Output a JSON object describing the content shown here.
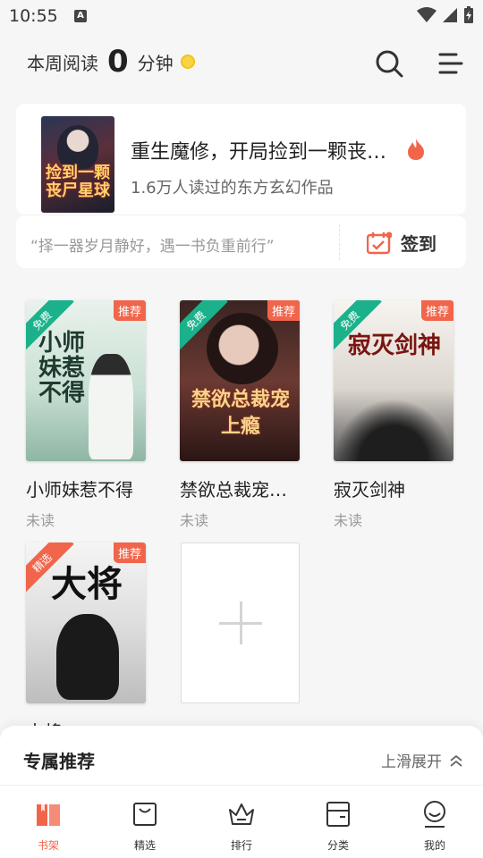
{
  "status_bar": {
    "time": "10:55",
    "notif_icon": "A"
  },
  "header": {
    "reading_prefix": "本周阅读",
    "reading_minutes": "0",
    "reading_suffix": "分钟",
    "coin_color": "#f7d347"
  },
  "featured": {
    "cover_title": "捡到一颗丧尸星球",
    "title": "重生魔修，开局捡到一颗丧尸星球",
    "subtitle": "1.6万人读过的东方玄幻作品"
  },
  "quote_bar": {
    "quote": "“择一器岁月静好，遇一书负重前行”",
    "sign_label": "签到"
  },
  "books": [
    {
      "title": "小师妹惹不得",
      "status": "未读",
      "badge": "推荐",
      "ribbon": "免费",
      "cover_text": "小师妹惹不得"
    },
    {
      "title": "禁欲总裁宠上瘾",
      "status": "未读",
      "badge": "推荐",
      "ribbon": "免费",
      "cover_text": "禁欲总裁宠上瘾"
    },
    {
      "title": "寂灭剑神",
      "status": "未读",
      "badge": "推荐",
      "ribbon": "免费",
      "cover_text": "寂灭剑神"
    },
    {
      "title": "大将",
      "status": "",
      "badge": "推荐",
      "ribbon": "精选",
      "cover_text": "大将"
    }
  ],
  "sheet": {
    "title": "专属推荐",
    "expand_label": "上滑展开"
  },
  "tabs": [
    {
      "label": "书架",
      "icon": "bookshelf-icon"
    },
    {
      "label": "精选",
      "icon": "bag-icon"
    },
    {
      "label": "排行",
      "icon": "crown-icon"
    },
    {
      "label": "分类",
      "icon": "category-icon"
    },
    {
      "label": "我的",
      "icon": "profile-icon"
    }
  ],
  "colors": {
    "accent": "#f1654b",
    "ribbon_green": "#1bb18b"
  }
}
